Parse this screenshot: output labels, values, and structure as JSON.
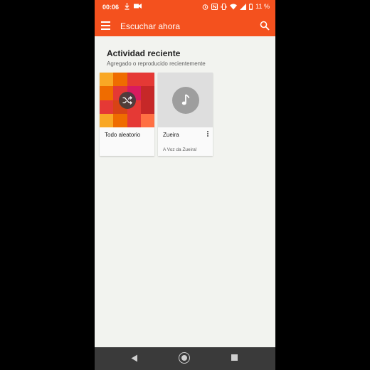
{
  "status_bar": {
    "time": "00:06",
    "battery": "11 %",
    "icons": [
      "download-icon",
      "video-camera-icon",
      "alarm-icon",
      "nfc-icon",
      "vibrate-icon",
      "wifi-icon",
      "signal-icon",
      "battery-icon"
    ]
  },
  "app_bar": {
    "title": "Escuchar ahora",
    "menu_icon": "menu-icon",
    "search_icon": "search-icon",
    "color": "#f4511e"
  },
  "recent": {
    "title": "Actividad reciente",
    "subtitle": "Agregado o reproducido recientemente",
    "cards": [
      {
        "label": "Todo aleatorio",
        "subtitle": "",
        "art": "shuffle-mosaic",
        "icon": "shuffle-icon"
      },
      {
        "label": "Zueira",
        "subtitle": "A Voz da Zueira!",
        "art": "music-note",
        "icon": "music-note-icon",
        "menu_icon": "more-vert-icon"
      }
    ]
  },
  "nav_bar": {
    "icons": [
      "back-icon",
      "home-icon",
      "recents-icon"
    ]
  },
  "colors": {
    "mosaic": [
      "#f9a825",
      "#ef6c00",
      "#e53935",
      "#e53935",
      "#ef6c00",
      "#e53935",
      "#d81b60",
      "#c62828",
      "#e53935",
      "#d84315",
      "#e53935",
      "#c62828",
      "#f9a825",
      "#ef6c00",
      "#e53935",
      "#ff7043"
    ]
  }
}
